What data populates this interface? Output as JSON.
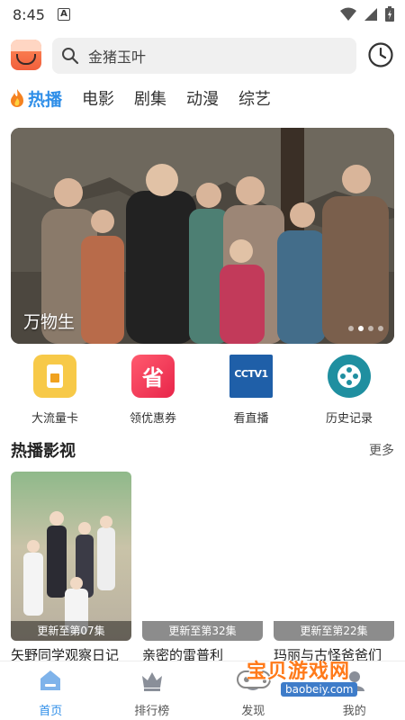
{
  "status": {
    "time": "8:45",
    "app_badge": "A"
  },
  "search": {
    "query": "金猪玉叶"
  },
  "tabs": [
    {
      "label": "热播",
      "active": true
    },
    {
      "label": "电影"
    },
    {
      "label": "剧集"
    },
    {
      "label": "动漫"
    },
    {
      "label": "综艺"
    }
  ],
  "banner": {
    "caption": "万物生",
    "slide_count": 4,
    "active_slide": 2
  },
  "shortcuts": [
    {
      "label": "大流量卡",
      "icon": "sim-card-icon",
      "color": "#f7c948"
    },
    {
      "label": "领优惠券",
      "icon": "coupon-icon",
      "color": "#f0364f",
      "glyph": "省"
    },
    {
      "label": "看直播",
      "icon": "cctv-icon",
      "color": "#1f5fa8",
      "glyph": "CCTV1"
    },
    {
      "label": "历史记录",
      "icon": "film-reel-icon",
      "color": "#1f8fa0"
    }
  ],
  "section": {
    "title": "热播影视",
    "more": "更多"
  },
  "cards": [
    {
      "title": "矢野同学观察日记",
      "update": "更新至第07集"
    },
    {
      "title": "亲密的雷普利",
      "update": "更新至第32集"
    },
    {
      "title": "玛丽与古怪爸爸们",
      "update": "更新至第22集"
    }
  ],
  "bottom_nav": [
    {
      "label": "首页",
      "icon": "home-icon",
      "active": true
    },
    {
      "label": "排行榜",
      "icon": "crown-icon"
    },
    {
      "label": "发现",
      "icon": "discover-icon"
    },
    {
      "label": "我的",
      "icon": "profile-icon"
    }
  ],
  "watermark": {
    "text": "宝贝游戏网",
    "url": "baobeiy.com"
  },
  "colors": {
    "accent": "#2e8ee8",
    "watermark": "#ff7a1a"
  }
}
